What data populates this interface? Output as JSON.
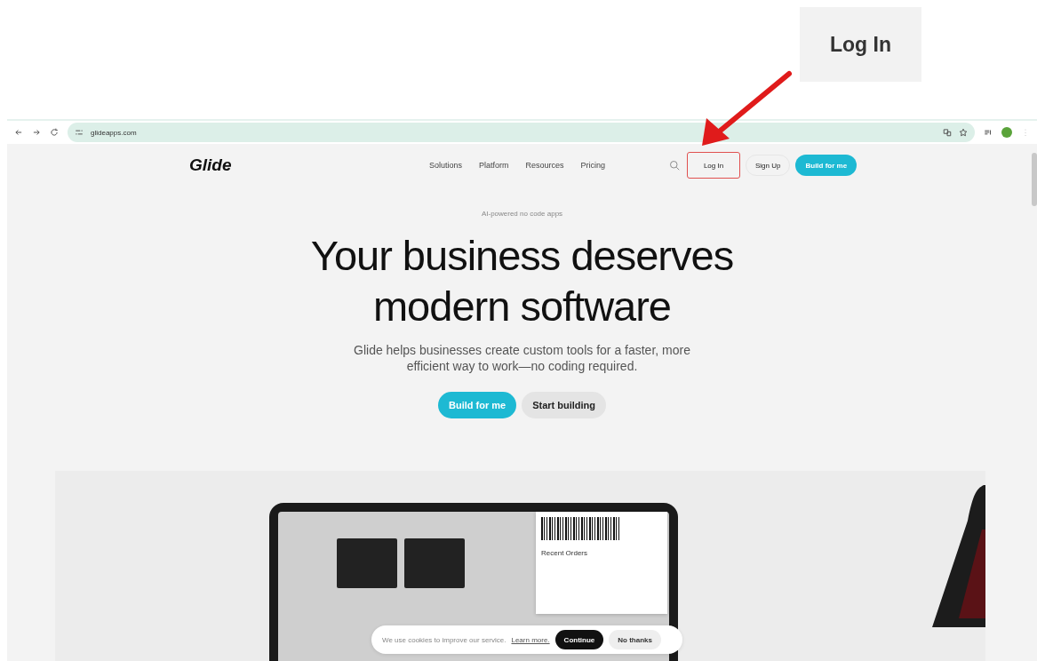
{
  "callout": {
    "label": "Log In"
  },
  "browser": {
    "url": "glideapps.com"
  },
  "nav": {
    "logo": "Glide",
    "links": [
      "Solutions",
      "Platform",
      "Resources",
      "Pricing"
    ],
    "buttons": [
      {
        "label": "Log In",
        "kind": "outline",
        "highlighted": true
      },
      {
        "label": "Sign Up",
        "kind": "ghost",
        "highlighted": false
      },
      {
        "label": "Build for me",
        "kind": "primary",
        "highlighted": false
      }
    ]
  },
  "hero": {
    "eyebrow": "AI-powered no code apps",
    "title_lines": [
      "Your business deserves",
      "modern software"
    ],
    "subtitle": "Glide helps businesses create custom tools for a faster, more efficient way to work—no coding required.",
    "buttons": [
      {
        "label": "Build for me",
        "kind": "primary"
      },
      {
        "label": "Start building",
        "kind": "secondary"
      }
    ]
  },
  "showcase": {
    "card_title": "Recent Orders"
  },
  "cookie_banner": {
    "text": "We use cookies to improve our service.",
    "link": "Learn more.",
    "buttons": [
      {
        "label": "Continue",
        "kind": "dark"
      },
      {
        "label": "No thanks",
        "kind": "light"
      }
    ]
  }
}
